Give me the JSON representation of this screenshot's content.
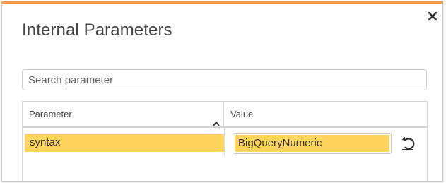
{
  "dialog": {
    "title": "Internal Parameters",
    "close_icon": "close-icon",
    "accent_color": "#f39a4a"
  },
  "search": {
    "placeholder": "Search parameter",
    "value": ""
  },
  "table": {
    "columns": [
      {
        "label": "Parameter",
        "sort_icon": "chevron-up-icon"
      },
      {
        "label": "Value"
      }
    ],
    "rows": [
      {
        "parameter": "syntax",
        "value": "BigQueryNumeric",
        "action_icon": "reset-icon",
        "highlight_color": "#ffd45c"
      }
    ]
  }
}
